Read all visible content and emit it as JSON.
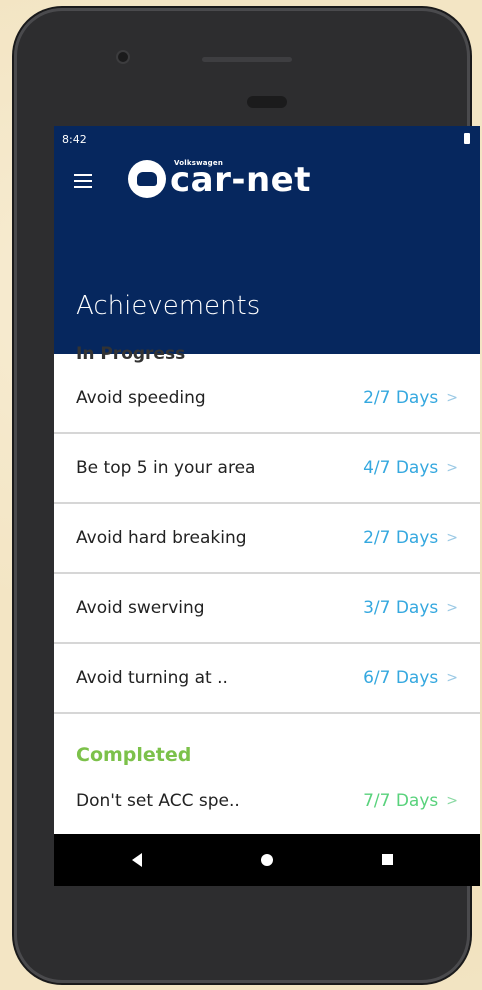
{
  "status": {
    "time": "8:42"
  },
  "brand": {
    "small": "Volkswagen",
    "name": "car-net"
  },
  "page": {
    "title": "Achievements"
  },
  "in_progress": {
    "header": "In Progress",
    "items": [
      {
        "label": "Avoid speeding",
        "value": "2/7 Days"
      },
      {
        "label": "Be top 5 in your area",
        "value": "4/7 Days"
      },
      {
        "label": "Avoid hard breaking",
        "value": "2/7 Days"
      },
      {
        "label": "Avoid swerving",
        "value": "3/7 Days"
      },
      {
        "label": "Avoid turning at ..",
        "value": "6/7 Days"
      }
    ]
  },
  "completed": {
    "header": "Completed",
    "items": [
      {
        "label": "Don't set ACC spe..",
        "value": "7/7 Days"
      }
    ]
  },
  "colors": {
    "appbar": "#06275e",
    "in_progress_value": "#35a8df",
    "completed_header": "#7cc14a",
    "completed_value": "#59d27c"
  },
  "icons": {
    "menu": "hamburger-menu-icon",
    "logo": "car-net-logo-icon",
    "chevron": "chevron-right-icon",
    "nav_back": "back-triangle-icon",
    "nav_home": "home-circle-icon",
    "nav_recent": "recent-square-icon"
  }
}
